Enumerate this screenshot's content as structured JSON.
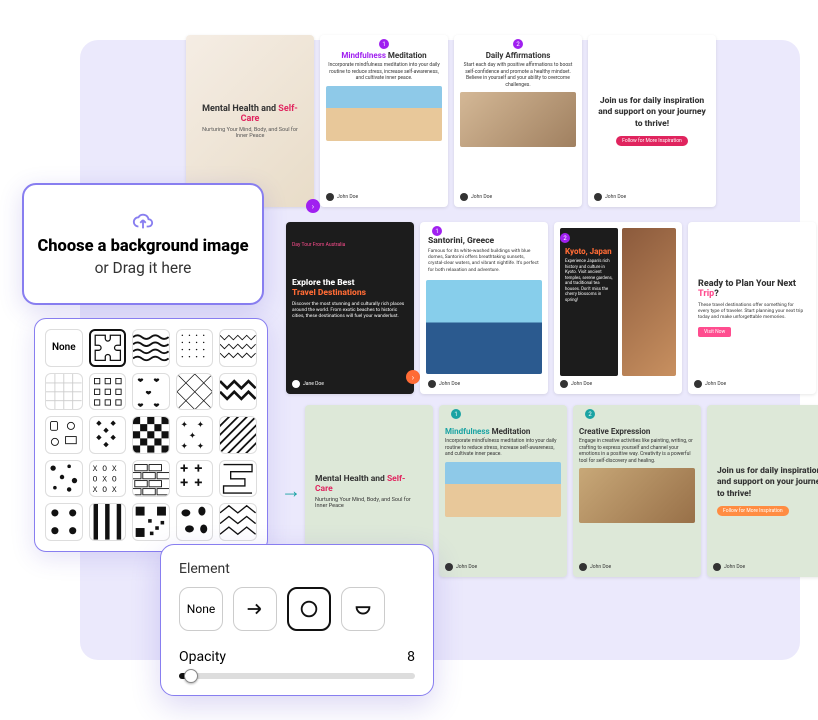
{
  "upload": {
    "icon": "cloud-upload-icon",
    "title": "Choose a background image",
    "subtitle": "or Drag it here"
  },
  "patterns": {
    "none_label": "None",
    "selected_index": 1
  },
  "element": {
    "label": "Element",
    "options": [
      {
        "name": "element-none",
        "label": "None"
      },
      {
        "name": "element-arrow",
        "icon": "arrow-right-icon"
      },
      {
        "name": "element-circle",
        "icon": "circle-icon"
      },
      {
        "name": "element-semicircle",
        "icon": "semicircle-icon"
      }
    ],
    "selected_index": 2,
    "opacity_label": "Opacity",
    "opacity_value": 8
  },
  "templates": {
    "row1": [
      {
        "title_a": "Mental Health and ",
        "title_b": "Self-Care",
        "sub": "Nurturing Your Mind, Body, and Soul for Inner Peace"
      },
      {
        "num": "1",
        "head_a": "Mindfulness",
        "head_b": " Meditation",
        "body": "Incorporate mindfulness meditation into your daily routine to reduce stress, increase self-awareness, and cultivate inner peace.",
        "author": "John Doe"
      },
      {
        "num": "2",
        "head": "Daily Affirmations",
        "body": "Start each day with positive affirmations to boost self-confidence and promote a healthy mindset. Believe in yourself and your ability to overcome challenges.",
        "author": "John Doe"
      },
      {
        "bold": "Join us for daily inspiration and support on your journey to thrive!",
        "btn": "Follow for More Inspiration",
        "author": "John Doe"
      }
    ],
    "row2": [
      {
        "tag": "Day Tour From Australia",
        "title_a": "Explore the Best ",
        "title_b": "Travel Destinations",
        "body": "Discover the most stunning and culturally rich places around the world. From exotic beaches to historic cities, these destinations will fuel your wanderlust.",
        "author": "Jane Doe"
      },
      {
        "num": "1",
        "head": "Santorini, Greece",
        "body": "Famous for its white-washed buildings with blue domes, Santorini offers breathtaking sunsets, crystal-clear waters, and vibrant nightlife. It's perfect for both relaxation and adventure.",
        "author": "John Doe"
      },
      {
        "num": "2",
        "head": "Kyoto, Japan",
        "body": "Experience Japan's rich history and culture in Kyoto. Visit ancient temples, serene gardens, and traditional tea houses. Don't miss the cherry blossoms in spring!",
        "author": "John Doe"
      },
      {
        "head_a": "Ready to Plan Your Next ",
        "head_b": "Trip",
        "head_c": "?",
        "body": "These travel destinations offer something for every type of traveler. Start planning your next trip today and make unforgettable memories.",
        "btn": "Visit Now",
        "author": "John Doe"
      }
    ],
    "row3": [
      {
        "title_a": "Mental Health and ",
        "title_b": "Self-Care",
        "sub": "Nurturing Your Mind, Body, and Soul for Inner Peace"
      },
      {
        "num": "1",
        "head_a": "Mindfulness",
        "head_b": " Meditation",
        "body": "Incorporate mindfulness meditation into your daily routine to reduce stress, increase self-awareness, and cultivate inner peace.",
        "author": "John Doe"
      },
      {
        "num": "2",
        "head": "Creative Expression",
        "body": "Engage in creative activities like painting, writing, or crafting to express yourself and channel your emotions in a positive way. Creativity is a powerful tool for self-discovery and healing.",
        "author": "John Doe"
      },
      {
        "bold": "Join us for daily inspiration and support on your journey to thrive!",
        "btn": "Follow for More Inspiration",
        "author": "John Doe"
      }
    ]
  }
}
